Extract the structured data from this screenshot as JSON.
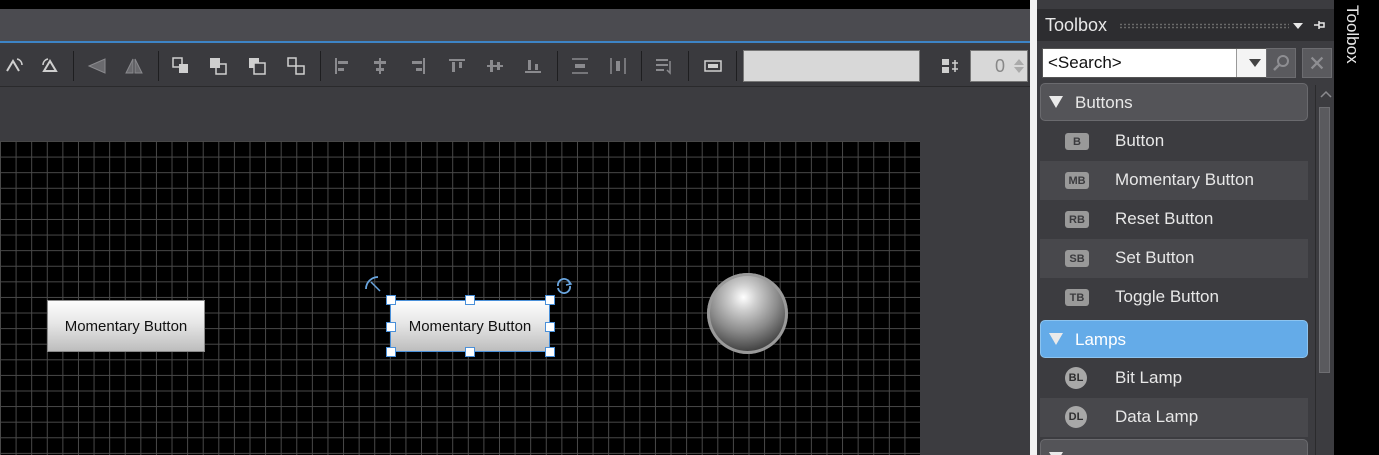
{
  "toolbar": {
    "text_field_value": "",
    "numeric_value": "0"
  },
  "canvas": {
    "button_left_label": "Momentary Button",
    "button_selected_label": "Momentary Button"
  },
  "toolbox": {
    "title": "Toolbox",
    "search_placeholder": "<Search>",
    "categories": [
      {
        "label": "Buttons",
        "items": [
          {
            "icon": "B",
            "label": "Button"
          },
          {
            "icon": "MB",
            "label": "Momentary Button"
          },
          {
            "icon": "RB",
            "label": "Reset Button"
          },
          {
            "icon": "SB",
            "label": "Set Button"
          },
          {
            "icon": "TB",
            "label": "Toggle Button"
          }
        ]
      },
      {
        "label": "Lamps",
        "items": [
          {
            "icon": "BL",
            "label": "Bit Lamp"
          },
          {
            "icon": "DL",
            "label": "Data Lamp"
          }
        ]
      }
    ]
  },
  "side_tab": {
    "label": "Toolbox"
  },
  "colors": {
    "selection_blue": "#4a90d9",
    "active_category": "#64abe8"
  }
}
